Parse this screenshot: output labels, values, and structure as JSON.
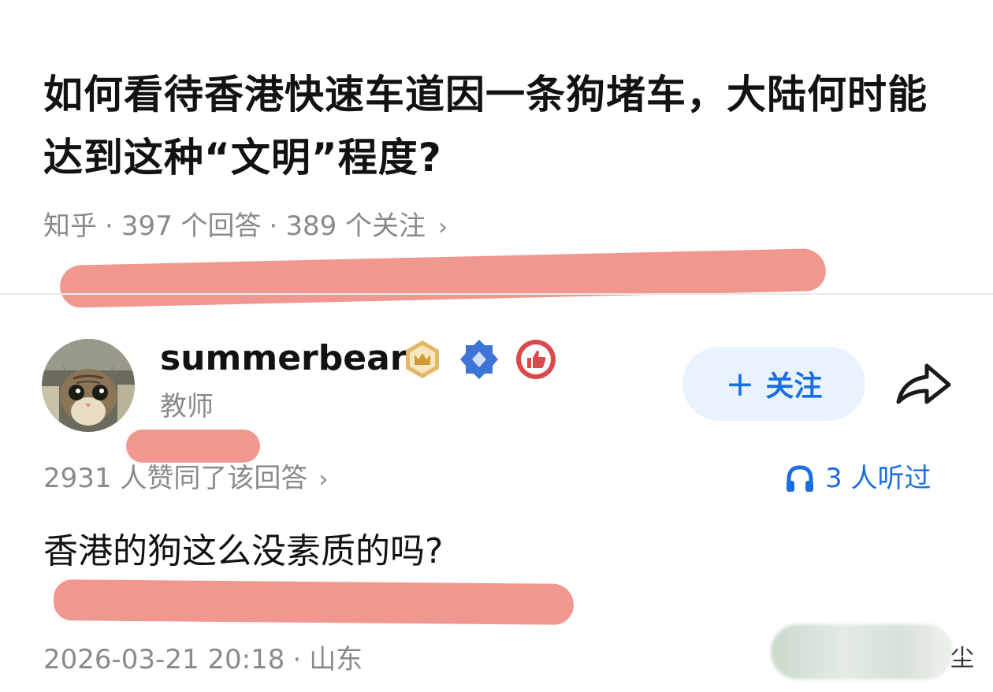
{
  "question": {
    "title": "如何看待香港快速车道因一条狗堵车，大陆何时能达到这种“文明”程度?",
    "meta": {
      "source": "知乎",
      "answers": "397 个回答",
      "followers": "389 个关注",
      "chevron": "›"
    }
  },
  "author": {
    "name": "summerbear",
    "title": "教师",
    "badges": [
      "crown-badge-icon",
      "diamond-badge-icon",
      "thumb-badge-icon"
    ],
    "follow_label": "关注",
    "follow_plus": "+"
  },
  "stats": {
    "approvals": "2931 人赞同了该回答",
    "chevron": "›",
    "listens": "3 人听过"
  },
  "answer": {
    "text": "香港的狗这么没素质的吗?",
    "time": "2026-03-21 20:18",
    "location": "山东",
    "edge_glyph": "尘"
  },
  "colors": {
    "accent": "#1a6fe0",
    "follow_bg": "#e9f3fe",
    "marker": "#ee8d84",
    "muted_text": "#8a8a8a",
    "heading_text": "#121212"
  },
  "icons": {
    "share": "share-arrow-icon",
    "headphones": "headphones-icon",
    "avatar": "cat-avatar"
  }
}
